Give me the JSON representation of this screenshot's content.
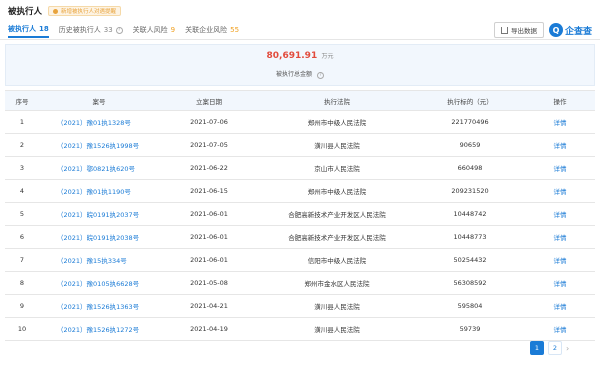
{
  "header": {
    "title": "被执行人",
    "tag": "新增被执行人对遇提醒"
  },
  "tabs": [
    {
      "label": "被执行人",
      "count": "18",
      "active": true
    },
    {
      "label": "历史被执行人",
      "count": "33",
      "active": false
    },
    {
      "label": "关联人风险",
      "count": "9",
      "active": false
    },
    {
      "label": "关联企业风险",
      "count": "55",
      "active": false
    }
  ],
  "toolbar": {
    "export_label": "导出数据",
    "logo_mark": "Q",
    "logo_text": "企查查"
  },
  "summary": {
    "amount": "80,691.91",
    "unit": "万元",
    "label": "被执行总金额"
  },
  "table": {
    "headers": [
      "序号",
      "案号",
      "立案日期",
      "执行法院",
      "执行标的（元）",
      "操作"
    ],
    "rows": [
      {
        "no": "1",
        "case": "（2021）豫01执1328号",
        "date": "2021-07-06",
        "court": "郑州市中级人民法院",
        "amount": "221770496",
        "action": "详情"
      },
      {
        "no": "2",
        "case": "（2021）豫1526执1998号",
        "date": "2021-07-05",
        "court": "潢川县人民法院",
        "amount": "90659",
        "action": "详情"
      },
      {
        "no": "3",
        "case": "（2021）鄂0821执620号",
        "date": "2021-06-22",
        "court": "京山市人民法院",
        "amount": "660498",
        "action": "详情"
      },
      {
        "no": "4",
        "case": "（2021）豫01执1190号",
        "date": "2021-06-15",
        "court": "郑州市中级人民法院",
        "amount": "209231520",
        "action": "详情"
      },
      {
        "no": "5",
        "case": "（2021）皖0191执2037号",
        "date": "2021-06-01",
        "court": "合肥高新技术产业开发区人民法院",
        "amount": "10448742",
        "action": "详情"
      },
      {
        "no": "6",
        "case": "（2021）皖0191执2038号",
        "date": "2021-06-01",
        "court": "合肥高新技术产业开发区人民法院",
        "amount": "10448773",
        "action": "详情"
      },
      {
        "no": "7",
        "case": "（2021）豫15执334号",
        "date": "2021-06-01",
        "court": "信阳市中级人民法院",
        "amount": "50254432",
        "action": "详情"
      },
      {
        "no": "8",
        "case": "（2021）豫0105执6628号",
        "date": "2021-05-08",
        "court": "郑州市金水区人民法院",
        "amount": "56308592",
        "action": "详情"
      },
      {
        "no": "9",
        "case": "（2021）豫1526执1363号",
        "date": "2021-04-21",
        "court": "潢川县人民法院",
        "amount": "595804",
        "action": "详情"
      },
      {
        "no": "10",
        "case": "（2021）豫1526执1272号",
        "date": "2021-04-19",
        "court": "潢川县人民法院",
        "amount": "59739",
        "action": "详情"
      }
    ]
  },
  "pager": {
    "current": "1",
    "pages": [
      "1",
      "2"
    ],
    "next": "›"
  }
}
